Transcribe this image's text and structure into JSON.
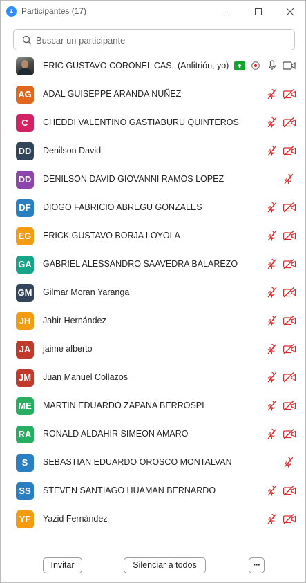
{
  "window": {
    "title": "Participantes (17)",
    "logo_glyph": "z",
    "accent": "#2d8cff"
  },
  "search": {
    "placeholder": "Buscar un participante",
    "value": ""
  },
  "host": {
    "name": "ERIC GUSTAVO CORONEL CAS...",
    "role": "(Anfitrión, yo)",
    "icons": [
      "share-screen-icon",
      "record-icon",
      "mic-on-icon",
      "video-on-icon"
    ]
  },
  "participants": [
    {
      "initials": "AG",
      "name": "ADAL GUISEPPE ARANDA NUÑEZ",
      "color": "#e0671d",
      "mic": "off",
      "video": "off"
    },
    {
      "initials": "C",
      "name": "CHEDDI VALENTINO GASTIABURU QUINTEROS",
      "color": "#d22266",
      "mic": "off",
      "video": "off"
    },
    {
      "initials": "DD",
      "name": "Denilson David",
      "color": "#33455a",
      "mic": "off",
      "video": "off"
    },
    {
      "initials": "DD",
      "name": "DENILSON DAVID GIOVANNI RAMOS LOPEZ",
      "color": "#8e44ad",
      "mic": "off",
      "video": "none"
    },
    {
      "initials": "DF",
      "name": "DIOGO FABRICIO ABREGU GONZALES",
      "color": "#2a7fc0",
      "mic": "off",
      "video": "off"
    },
    {
      "initials": "EG",
      "name": "ERICK GUSTAVO BORJA LOYOLA",
      "color": "#f39c12",
      "mic": "off",
      "video": "off"
    },
    {
      "initials": "GA",
      "name": "GABRIEL ALESSANDRO SAAVEDRA BALAREZO",
      "color": "#17a589",
      "mic": "off",
      "video": "off"
    },
    {
      "initials": "GM",
      "name": "Gilmar Moran Yaranga",
      "color": "#33455a",
      "mic": "off",
      "video": "off"
    },
    {
      "initials": "JH",
      "name": "Jahir Hernández",
      "color": "#f39c12",
      "mic": "off",
      "video": "off"
    },
    {
      "initials": "JA",
      "name": "jaime alberto",
      "color": "#c0392b",
      "mic": "off",
      "video": "off"
    },
    {
      "initials": "JM",
      "name": "Juan Manuel Collazos",
      "color": "#c0392b",
      "mic": "off",
      "video": "off"
    },
    {
      "initials": "ME",
      "name": "MARTIN EDUARDO ZAPANA BERROSPI",
      "color": "#27ae60",
      "mic": "off",
      "video": "off"
    },
    {
      "initials": "RA",
      "name": "RONALD ALDAHIR SIMEON AMARO",
      "color": "#27ae60",
      "mic": "off",
      "video": "off"
    },
    {
      "initials": "S",
      "name": "SEBASTIAN EDUARDO OROSCO MONTALVAN",
      "color": "#2a7fc0",
      "mic": "off",
      "video": "none"
    },
    {
      "initials": "SS",
      "name": "STEVEN SANTIAGO HUAMAN BERNARDO",
      "color": "#2a7fc0",
      "mic": "off",
      "video": "off"
    },
    {
      "initials": "YF",
      "name": "Yazid Fernàndez",
      "color": "#f39c12",
      "mic": "off",
      "video": "off"
    }
  ],
  "footer": {
    "invite_label": "Invitar",
    "mute_all_label": "Silenciar a todos",
    "more_label": "···"
  },
  "colors": {
    "muted_red": "#e02828",
    "share_green": "#12a52c"
  }
}
